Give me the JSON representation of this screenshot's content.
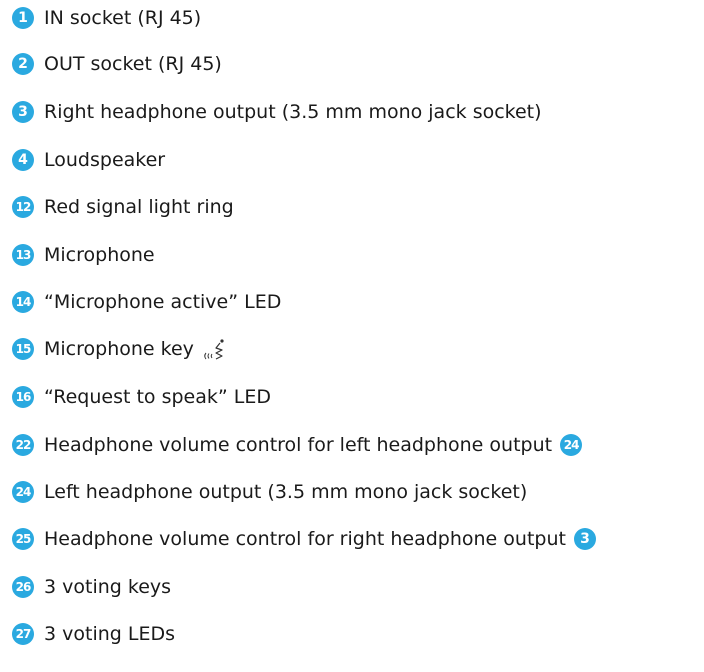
{
  "legend": {
    "accent_color": "#2aa9e0",
    "items": [
      {
        "number": "1",
        "text": "IN socket (RJ 45)"
      },
      {
        "number": "2",
        "text": "OUT socket (RJ 45)"
      },
      {
        "number": "3",
        "text": "Right headphone output (3.5 mm mono jack socket)"
      },
      {
        "number": "4",
        "text": "Loudspeaker"
      },
      {
        "number": "12",
        "text": "Red signal light ring"
      },
      {
        "number": "13",
        "text": "Microphone"
      },
      {
        "number": "14",
        "text": "“Microphone active” LED"
      },
      {
        "number": "15",
        "text": "Microphone key",
        "icon": "microphone-key-icon"
      },
      {
        "number": "16",
        "text": "“Request to speak” LED"
      },
      {
        "number": "22",
        "text": "Headphone volume control for left headphone output",
        "ref": "24"
      },
      {
        "number": "24",
        "text": "Left headphone output (3.5 mm mono jack socket)"
      },
      {
        "number": "25",
        "text": "Headphone volume control for right headphone output",
        "ref": "3"
      },
      {
        "number": "26",
        "text": "3 voting keys"
      },
      {
        "number": "27",
        "text": "3 voting LEDs"
      }
    ]
  }
}
